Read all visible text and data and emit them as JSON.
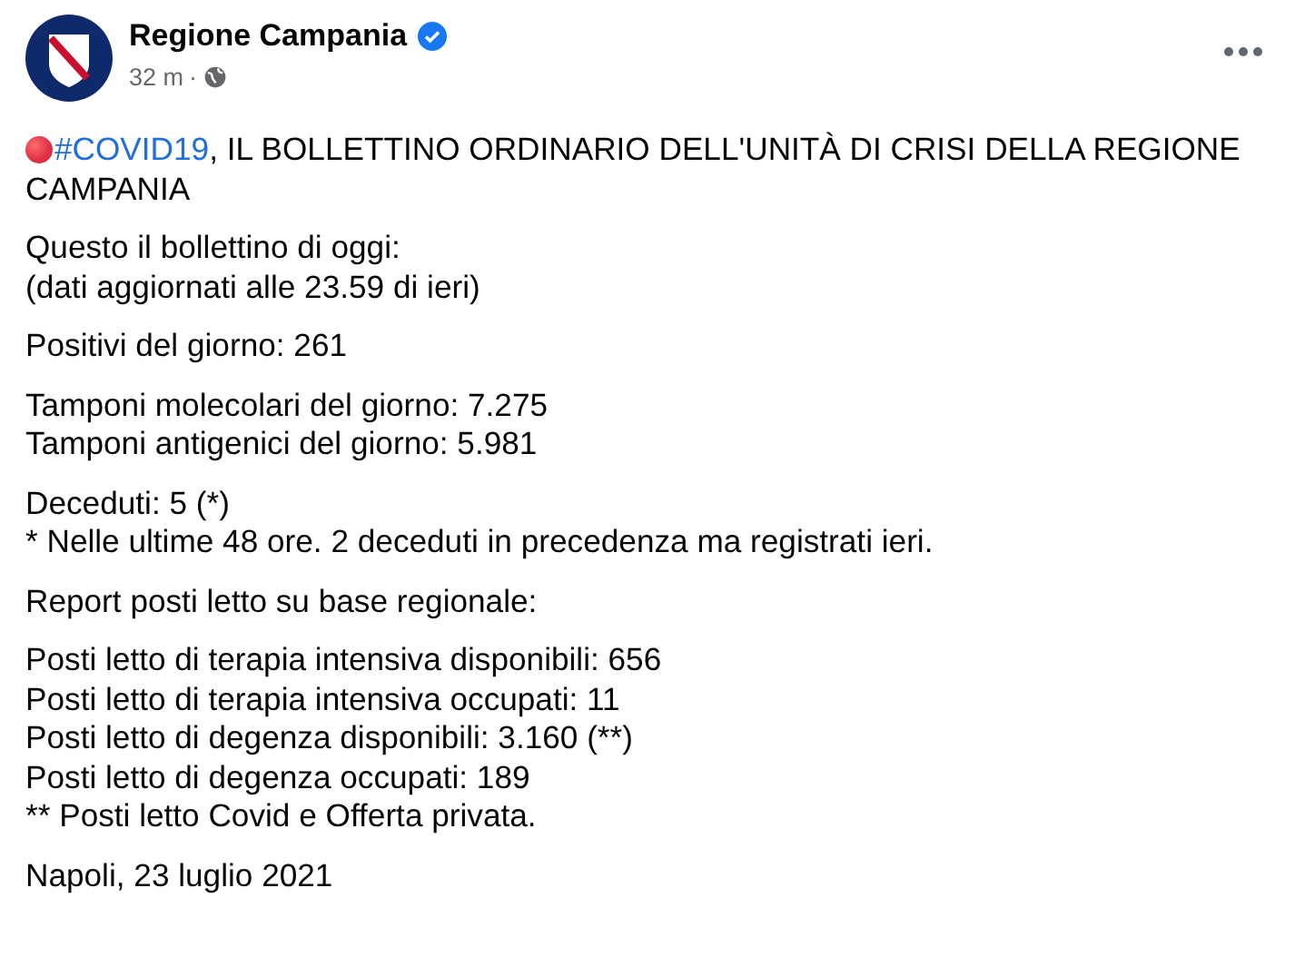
{
  "post": {
    "author": "Regione Campania",
    "verified": true,
    "time": "32 m",
    "separator": "·",
    "headline": {
      "hashtag": "#COVID19",
      "text": ", IL BOLLETTINO ORDINARIO DELL'UNITÀ DI CRISI DELLA REGIONE CAMPANIA"
    },
    "paragraphs": [
      [
        "Questo il bollettino di oggi:",
        "(dati aggiornati alle 23.59 di ieri)"
      ],
      [
        "Positivi del giorno: 261"
      ],
      [
        "Tamponi molecolari del giorno: 7.275",
        "Tamponi antigenici del giorno: 5.981"
      ],
      [
        "Deceduti: 5 (*)",
        "* Nelle ultime 48 ore. 2 deceduti in precedenza ma registrati ieri."
      ],
      [
        "Report posti letto su base regionale:"
      ],
      [
        "Posti letto di terapia intensiva disponibili: 656",
        "Posti letto di terapia intensiva occupati: 11",
        "Posti letto di degenza disponibili: 3.160 (**)",
        "Posti letto di degenza occupati: 189",
        "** Posti letto Covid e Offerta privata."
      ],
      [
        "Napoli, 23 luglio 2021"
      ]
    ]
  }
}
